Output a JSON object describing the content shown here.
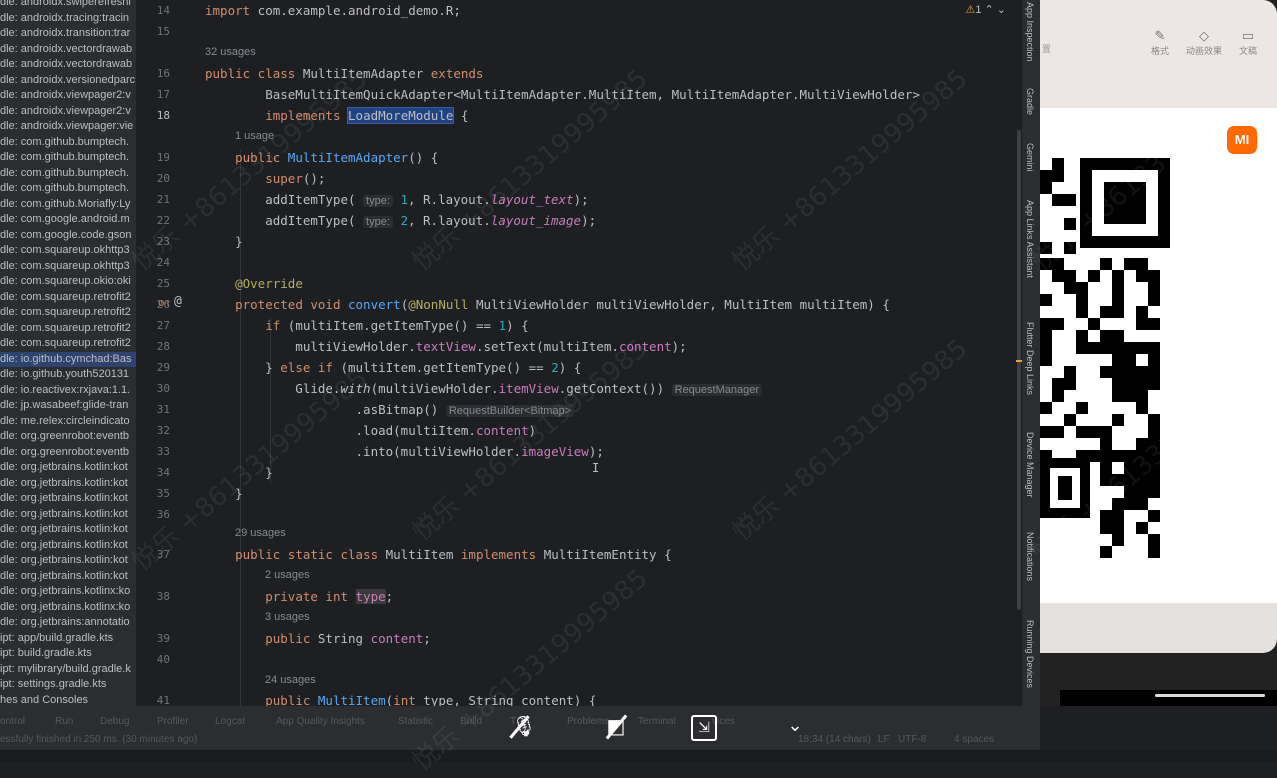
{
  "project_tree": [
    "dle: androidx.swiperefreshl",
    "dle: androidx.tracing:tracin",
    "dle: androidx.transition:trar",
    "dle: androidx.vectordrawab",
    "dle: androidx.vectordrawab",
    "dle: androidx.versionedparc",
    "dle: androidx.viewpager2:v",
    "dle: androidx.viewpager2:v",
    "dle: androidx.viewpager:vie",
    "dle: com.github.bumptech.",
    "dle: com.github.bumptech.",
    "dle: com.github.bumptech.",
    "dle: com.github.bumptech.",
    "dle: com.github.Moriafly:Ly",
    "dle: com.google.android.m",
    "dle: com.google.code.gson",
    "dle: com.squareup.okhttp3",
    "dle: com.squareup.okhttp3",
    "dle: com.squareup.okio:oki",
    "dle: com.squareup.retrofit2",
    "dle: com.squareup.retrofit2",
    "dle: com.squareup.retrofit2",
    "dle: com.squareup.retrofit2",
    "dle: io.github.cymchad:Bas",
    "dle: io.github.youth520131",
    "dle: io.reactivex:rxjava:1.1.",
    "dle: jp.wasabeef:glide-tran",
    "dle: me.relex:circleindicato",
    "dle: org.greenrobot:eventb",
    "dle: org.greenrobot:eventb",
    "dle: org.jetbrains.kotlin:kot",
    "dle: org.jetbrains.kotlin:kot",
    "dle: org.jetbrains.kotlin:kot",
    "dle: org.jetbrains.kotlin:kot",
    "dle: org.jetbrains.kotlin:kot",
    "dle: org.jetbrains.kotlin:kot",
    "dle: org.jetbrains.kotlin:kot",
    "dle: org.jetbrains.kotlin:kot",
    "dle: org.jetbrains.kotlinx:ko",
    "dle: org.jetbrains.kotlinx:ko",
    "dle: org.jetbrains:annotatio",
    "ipt: app/build.gradle.kts",
    "ipt: build.gradle.kts",
    "ipt: mylibrary/build.gradle.k",
    "ipt: settings.gradle.kts",
    "hes and Consoles"
  ],
  "editor": {
    "warning_count": "1",
    "line_numbers": [
      "14",
      "15",
      "16",
      "17",
      "18",
      "19",
      "20",
      "21",
      "22",
      "23",
      "24",
      "25",
      "26",
      "27",
      "28",
      "29",
      "30",
      "31",
      "32",
      "33",
      "34",
      "35",
      "36",
      "37",
      "38",
      "39",
      "40",
      "41"
    ],
    "hints": {
      "usages_32": "32 usages",
      "usage_1": "1 usage",
      "usages_29": "29 usages",
      "usages_2": "2 usages",
      "usages_3": "3 usages",
      "usages_24": "24 usages",
      "inlay_type": "type:",
      "inlay_request_manager": "RequestManager",
      "inlay_request_builder": "RequestBuilder<Bitmap>"
    }
  },
  "tool_windows_right": [
    "App Inspection",
    "Gradle",
    "Gemini",
    "App Links Assistant",
    "Flutter Deep Links",
    "Device Manager",
    "Notifications",
    "Running Devices"
  ],
  "device": {
    "toolbar": [
      {
        "label": "格式",
        "icon": "brush-icon"
      },
      {
        "label": "动画效果",
        "icon": "diamond-icon"
      },
      {
        "label": "文稿",
        "icon": "document-icon"
      }
    ],
    "left_cut_label": "置",
    "logo_text": "MI"
  },
  "status_bar": {
    "tools": [
      "ontrol",
      "Run",
      "Debug",
      "Profiler",
      "Logcat",
      "App Quality Insights",
      "Statistic",
      "Build",
      "T",
      "Problems",
      "Terminal",
      "vices"
    ],
    "message": "essfully finished in 250 ms. (30 minutes ago)",
    "position": "18:34 (14 chars)",
    "line_sep": "LF",
    "encoding": "UTF-8",
    "indent": "4 spaces"
  },
  "watermark": "悦乐 +8613319995985",
  "colors": {
    "bg": "#1e1f22",
    "keyword": "#cf8e6d",
    "function": "#56a8f5",
    "number": "#2aacb8",
    "field": "#c77dbb",
    "annotation": "#b3ae60"
  }
}
